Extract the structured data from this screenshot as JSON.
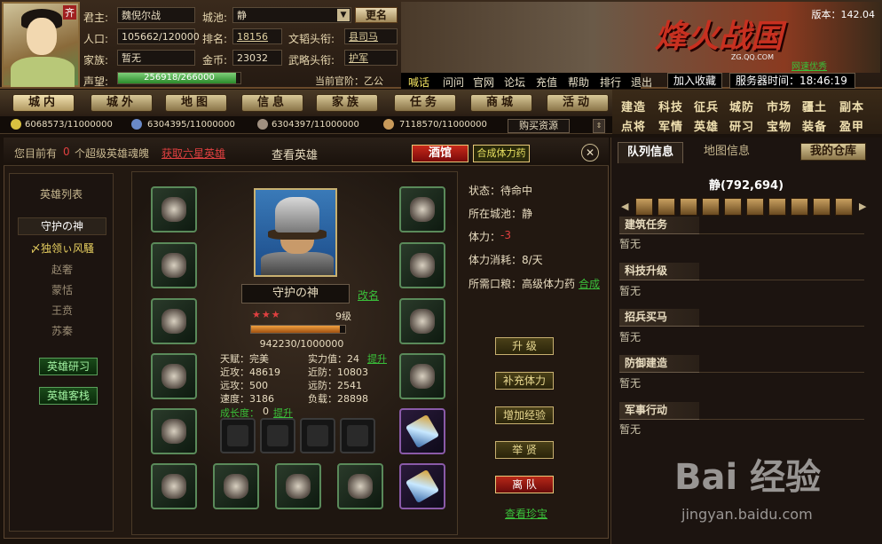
{
  "top": {
    "portrait_badge": "齐",
    "lord_label": "君主:",
    "lord": "魏倪尔战",
    "pop_label": "人口:",
    "pop": "105662/120000",
    "family_label": "家族:",
    "family": "暂无",
    "rep_label": "声望:",
    "rep": "256918/266000",
    "rep_fraction": 0.966,
    "city_label": "城池:",
    "city": "静",
    "rank_label": "排名:",
    "rank": "18156",
    "gold_label": "金币:",
    "gold": "23032",
    "civ_label": "文韬头衔:",
    "civ": "县司马",
    "mil_label": "武略头衔:",
    "mil": "护军",
    "stage": "当前官阶：乙公",
    "rename": "更名",
    "version": "版本：142.04",
    "logo": "烽火战国",
    "zg": "ZG.QQ.COM",
    "net": "网速优秀",
    "links": [
      "喊话",
      "问问",
      "官网",
      "论坛",
      "充值",
      "帮助",
      "排行",
      "退出"
    ],
    "favorite": "加入收藏",
    "server_time": "服务器时间：18:46:19"
  },
  "nav": [
    "城内",
    "城外",
    "地图",
    "信息",
    "家族",
    "任务",
    "商城",
    "活动"
  ],
  "rmenu": [
    [
      "建造",
      "科技",
      "征兵",
      "城防",
      "市场",
      "疆土",
      "副本"
    ],
    [
      "点将",
      "军情",
      "英雄",
      "研习",
      "宝物",
      "装备",
      "盈甲"
    ]
  ],
  "resources": [
    "6068573/11000000",
    "6304395/11000000",
    "6304397/11000000",
    "7118570/11000000"
  ],
  "buy_res": "购买资源",
  "panel": {
    "hint_pre": "您目前有",
    "hint_num": "0",
    "hint_post": "个超级英雄魂魄",
    "hint_link": "获取六星英雄",
    "title": "查看英雄",
    "tavern": "酒馆",
    "synth": "合成体力药",
    "close": "✕"
  },
  "herolist": {
    "title": "英雄列表",
    "items": [
      "守护の神",
      "〆独领ぃ风騷",
      "赵奢",
      "蒙恬",
      "王贲",
      "苏秦"
    ],
    "research": "英雄研习",
    "inn": "英雄客栈"
  },
  "hero": {
    "name": "守护の神",
    "rename": "改名",
    "stars": "★★★",
    "level": "9级",
    "exp": "942230/1000000",
    "exp_fraction": 0.942,
    "talent": "天赋：完美",
    "power": "实力值：24",
    "boost": "提升",
    "atk_near": "近攻：48619",
    "def_near": "近防：10803",
    "atk_far": "远攻：500",
    "def_far": "远防：2541",
    "speed": "速度：3186",
    "load": "负载：28898",
    "growth": "成长度：",
    "growth_val": "0",
    "growth_boost": "提升"
  },
  "status": {
    "state": "状态：待命中",
    "city": "所在城池：静",
    "stamina_label": "体力：",
    "stamina": "-3",
    "consume": "体力消耗：8/天",
    "food_label": "所需口粮：高级体力药",
    "synth": "合成"
  },
  "actions": [
    "升 级",
    "补充体力",
    "增加经验",
    "举 贤",
    "离 队"
  ],
  "treasure": "查看珍宝",
  "right": {
    "tab1": "队列信息",
    "tab2": "地图信息",
    "warehouse": "我的仓库",
    "location": "静(792,694)",
    "sections": [
      {
        "title": "建筑任务",
        "value": "暂无"
      },
      {
        "title": "科技升级",
        "value": "暂无"
      },
      {
        "title": "招兵买马",
        "value": "暂无"
      },
      {
        "title": "防御建造",
        "value": "暂无"
      },
      {
        "title": "军事行动",
        "value": "暂无"
      }
    ]
  },
  "watermark": "Bai 经验",
  "watermark2": "jingyan.baidu.com"
}
